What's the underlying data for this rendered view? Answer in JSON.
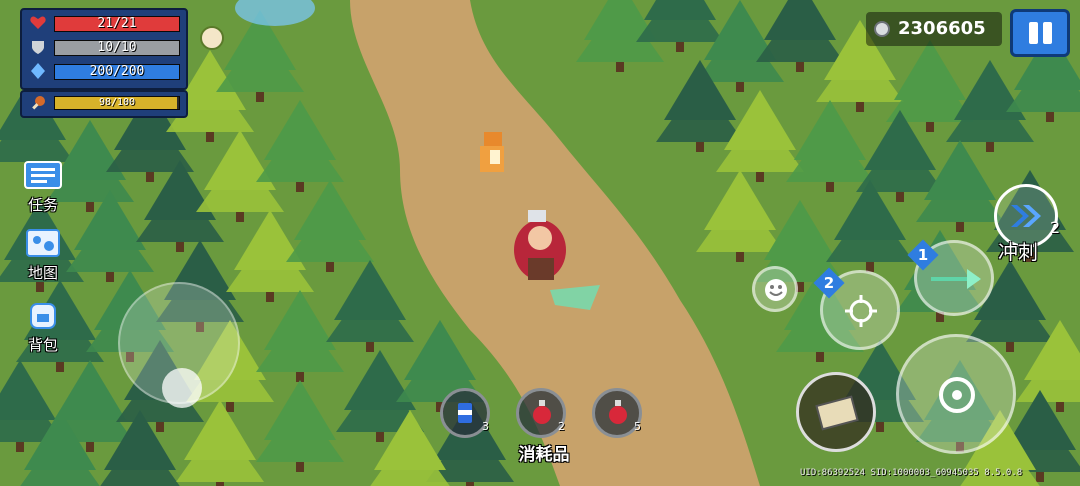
{
  "hud": {
    "hp": {
      "text": "21/21",
      "fraction": 1.0,
      "color": "#e03b3b"
    },
    "armor": {
      "text": "10/10",
      "fraction": 1.0,
      "color": "#9a9ea3"
    },
    "energy": {
      "text": "200/200",
      "fraction": 1.0,
      "color": "#2f7de0"
    },
    "xp": {
      "text": "98/100",
      "fraction": 0.98,
      "color": "#d7b22a"
    }
  },
  "coins": {
    "value": "2306605"
  },
  "menu": [
    {
      "label": "任务",
      "icon": "quest-icon"
    },
    {
      "label": "地图",
      "icon": "map-icon"
    },
    {
      "label": "背包",
      "icon": "backpack-icon"
    }
  ],
  "consumables": {
    "label": "消耗品",
    "items": [
      {
        "icon": "can-icon",
        "count": "3"
      },
      {
        "icon": "red-potion-icon",
        "count": "2"
      },
      {
        "icon": "red-potion-icon",
        "count": "5"
      }
    ]
  },
  "controls": {
    "dash_label": "冲刺",
    "dash_count": "2",
    "weapon_slot_1": "1",
    "weapon_slot_2": "2"
  },
  "footer": {
    "uid": "UID:86392524 SID:1000003_60945035 8.5.0.8"
  }
}
